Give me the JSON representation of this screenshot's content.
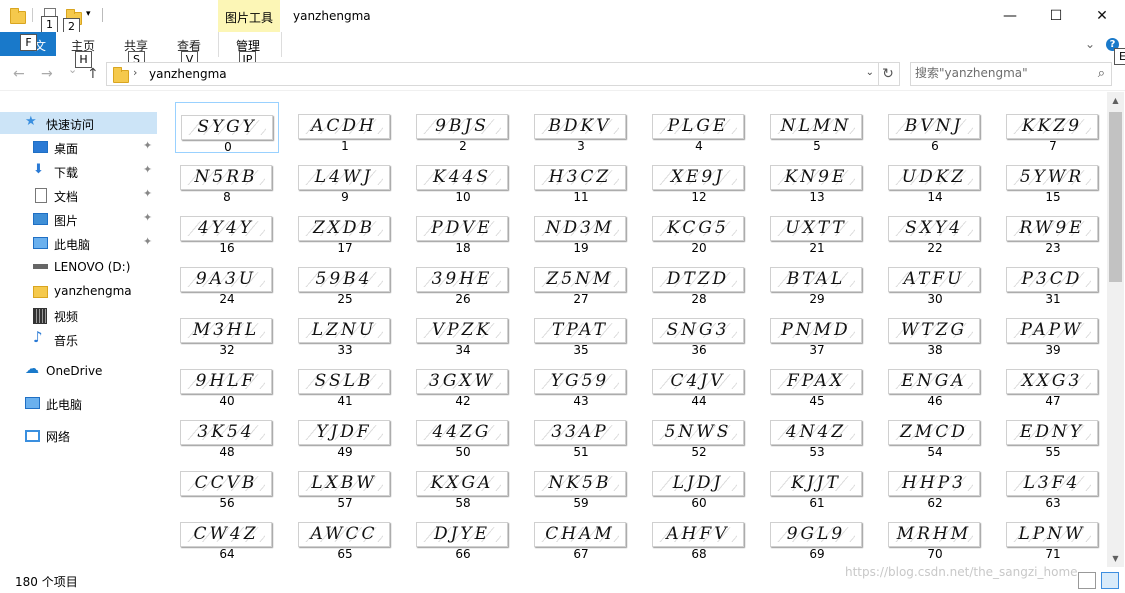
{
  "titlebar": {
    "context_tab": "图片工具",
    "window_title": "yanzhengma",
    "keytips": {
      "qa1": "1",
      "qa2": "2"
    },
    "controls": {
      "minimize": "—",
      "maximize": "☐",
      "close": "✕"
    }
  },
  "ribbon": {
    "file_tab": "文件",
    "file_keytip": "F",
    "tabs": [
      {
        "label": "主页",
        "keytip": "H"
      },
      {
        "label": "共享",
        "keytip": "S"
      },
      {
        "label": "查看",
        "keytip": "V"
      }
    ],
    "manage_tab": {
      "label": "管理",
      "keytip": "JP"
    },
    "help_keytip": "E"
  },
  "addressbar": {
    "back": "←",
    "forward": "→",
    "recent": "⌄",
    "up": "↑",
    "separator": "›",
    "path": "yanzhengma",
    "search_placeholder": "搜索\"yanzhengma\""
  },
  "navpane": {
    "items": [
      {
        "label": "快速访问",
        "icon": "star-icon",
        "pinned": false
      },
      {
        "label": "桌面",
        "icon": "desktop-icon",
        "pinned": true
      },
      {
        "label": "下载",
        "icon": "download-icon",
        "pinned": true
      },
      {
        "label": "文档",
        "icon": "document-icon",
        "pinned": true
      },
      {
        "label": "图片",
        "icon": "picture-icon",
        "pinned": true
      },
      {
        "label": "此电脑",
        "icon": "computer-icon",
        "pinned": true
      },
      {
        "label": "LENOVO (D:)",
        "icon": "drive-icon",
        "pinned": false
      },
      {
        "label": "yanzhengma",
        "icon": "folder-icon",
        "pinned": false
      },
      {
        "label": "视频",
        "icon": "video-icon",
        "pinned": false
      },
      {
        "label": "音乐",
        "icon": "music-icon",
        "pinned": false
      },
      {
        "label": "OneDrive",
        "icon": "onedrive-icon",
        "pinned": false
      },
      {
        "label": "此电脑",
        "icon": "computer-icon",
        "pinned": false
      },
      {
        "label": "网络",
        "icon": "network-icon",
        "pinned": false
      }
    ],
    "pin_glyph": "📌"
  },
  "files": [
    {
      "name": "0",
      "captcha": "SYGY"
    },
    {
      "name": "1",
      "captcha": "ACDH"
    },
    {
      "name": "2",
      "captcha": "9BJS"
    },
    {
      "name": "3",
      "captcha": "BDKV"
    },
    {
      "name": "4",
      "captcha": "PLGE"
    },
    {
      "name": "5",
      "captcha": "NLMN"
    },
    {
      "name": "6",
      "captcha": "BVNJ"
    },
    {
      "name": "7",
      "captcha": "KKZ9"
    },
    {
      "name": "8",
      "captcha": "N5RB"
    },
    {
      "name": "9",
      "captcha": "L4WJ"
    },
    {
      "name": "10",
      "captcha": "K44S"
    },
    {
      "name": "11",
      "captcha": "H3CZ"
    },
    {
      "name": "12",
      "captcha": "XE9J"
    },
    {
      "name": "13",
      "captcha": "KN9E"
    },
    {
      "name": "14",
      "captcha": "UDKZ"
    },
    {
      "name": "15",
      "captcha": "5YWR"
    },
    {
      "name": "16",
      "captcha": "4Y4Y"
    },
    {
      "name": "17",
      "captcha": "ZXDB"
    },
    {
      "name": "18",
      "captcha": "PDVE"
    },
    {
      "name": "19",
      "captcha": "ND3M"
    },
    {
      "name": "20",
      "captcha": "KCG5"
    },
    {
      "name": "21",
      "captcha": "UXTT"
    },
    {
      "name": "22",
      "captcha": "SXY4"
    },
    {
      "name": "23",
      "captcha": "RW9E"
    },
    {
      "name": "24",
      "captcha": "9A3U"
    },
    {
      "name": "25",
      "captcha": "59B4"
    },
    {
      "name": "26",
      "captcha": "39HE"
    },
    {
      "name": "27",
      "captcha": "Z5NM"
    },
    {
      "name": "28",
      "captcha": "DTZD"
    },
    {
      "name": "29",
      "captcha": "BTAL"
    },
    {
      "name": "30",
      "captcha": "ATFU"
    },
    {
      "name": "31",
      "captcha": "P3CD"
    },
    {
      "name": "32",
      "captcha": "M3HL"
    },
    {
      "name": "33",
      "captcha": "LZNU"
    },
    {
      "name": "34",
      "captcha": "VPZK"
    },
    {
      "name": "35",
      "captcha": "TPAT"
    },
    {
      "name": "36",
      "captcha": "SNG3"
    },
    {
      "name": "37",
      "captcha": "PNMD"
    },
    {
      "name": "38",
      "captcha": "WTZG"
    },
    {
      "name": "39",
      "captcha": "PAPW"
    },
    {
      "name": "40",
      "captcha": "9HLF"
    },
    {
      "name": "41",
      "captcha": "SSLB"
    },
    {
      "name": "42",
      "captcha": "3GXW"
    },
    {
      "name": "43",
      "captcha": "YG59"
    },
    {
      "name": "44",
      "captcha": "C4JV"
    },
    {
      "name": "45",
      "captcha": "FPAX"
    },
    {
      "name": "46",
      "captcha": "ENGA"
    },
    {
      "name": "47",
      "captcha": "XXG3"
    },
    {
      "name": "48",
      "captcha": "3K54"
    },
    {
      "name": "49",
      "captcha": "YJDF"
    },
    {
      "name": "50",
      "captcha": "44ZG"
    },
    {
      "name": "51",
      "captcha": "33AP"
    },
    {
      "name": "52",
      "captcha": "5NWS"
    },
    {
      "name": "53",
      "captcha": "4N4Z"
    },
    {
      "name": "54",
      "captcha": "ZMCD"
    },
    {
      "name": "55",
      "captcha": "EDNY"
    },
    {
      "name": "56",
      "captcha": "CCVB"
    },
    {
      "name": "57",
      "captcha": "LXBW"
    },
    {
      "name": "58",
      "captcha": "KXGA"
    },
    {
      "name": "59",
      "captcha": "NK5B"
    },
    {
      "name": "60",
      "captcha": "LJDJ"
    },
    {
      "name": "61",
      "captcha": "KJJT"
    },
    {
      "name": "62",
      "captcha": "HHP3"
    },
    {
      "name": "63",
      "captcha": "L3F4"
    },
    {
      "name": "64",
      "captcha": "CW4Z"
    },
    {
      "name": "65",
      "captcha": "AWCC"
    },
    {
      "name": "66",
      "captcha": "DJYE"
    },
    {
      "name": "67",
      "captcha": "CHAM"
    },
    {
      "name": "68",
      "captcha": "AHFV"
    },
    {
      "name": "69",
      "captcha": "9GL9"
    },
    {
      "name": "70",
      "captcha": "MRHM"
    },
    {
      "name": "71",
      "captcha": "LPNW"
    }
  ],
  "selected_index": 0,
  "statusbar": {
    "item_count": "180 个项目"
  },
  "watermark": "https://blog.csdn.net/the_sangzi_home",
  "colors": {
    "accent": "#1979ca",
    "context_tab_bg": "#fcf6b6",
    "nav_selected": "#cce4f7",
    "selection_border": "#99d1ff"
  }
}
